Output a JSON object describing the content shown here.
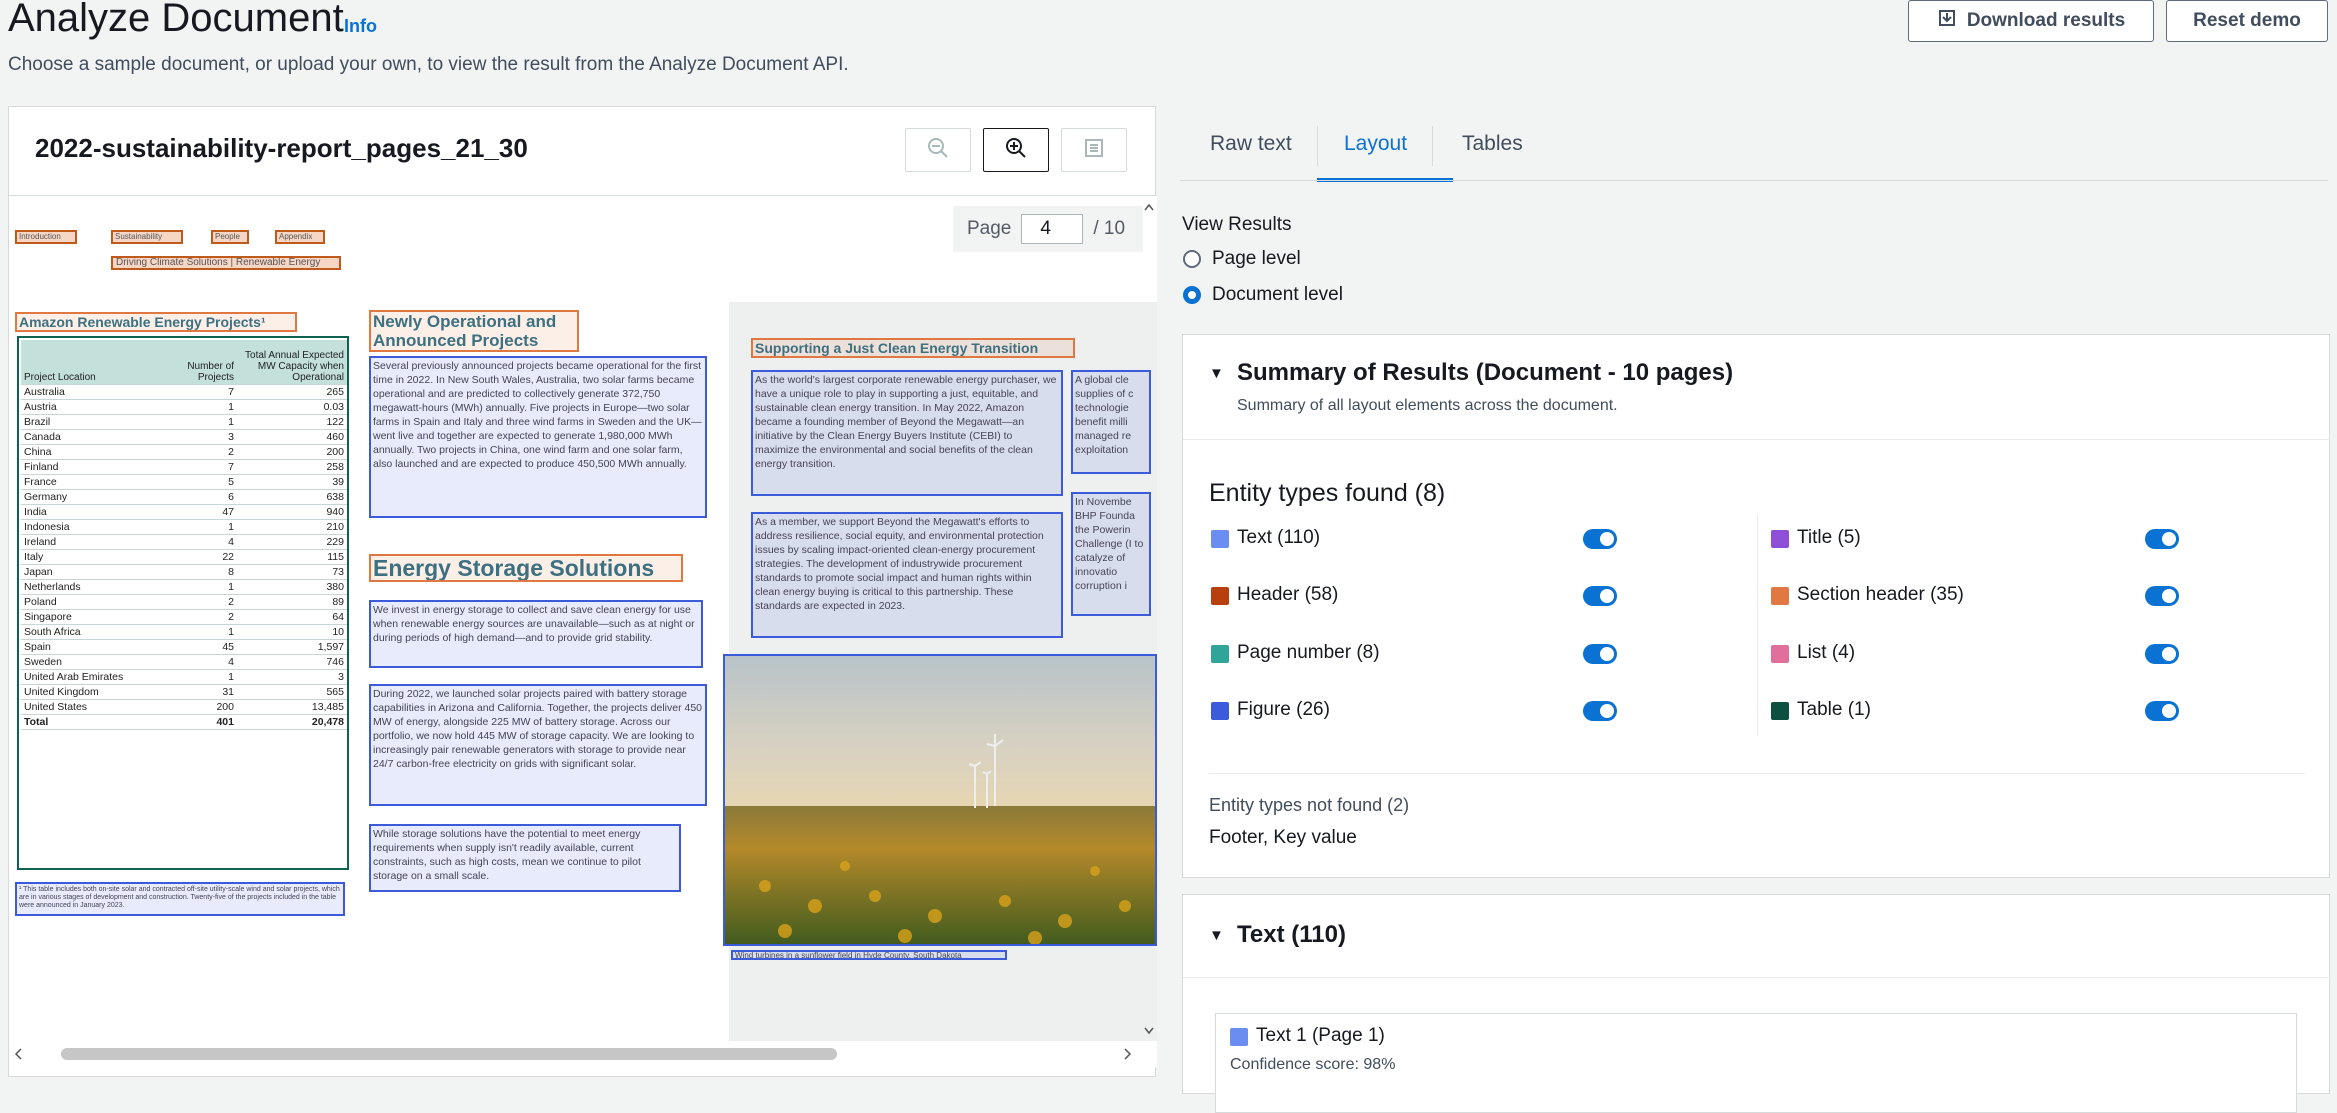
{
  "page": {
    "title": "Analyze Document",
    "info_link": "Info",
    "subtitle": "Choose a sample document, or upload your own, to view the result from the Analyze Document API.",
    "download_label": "Download results",
    "reset_label": "Reset demo"
  },
  "viewer": {
    "doc_title": "2022-sustainability-report_pages_21_30",
    "page_label": "Page",
    "page_value": "4",
    "page_total": "/ 10",
    "nav": [
      "Introduction",
      "Sustainability",
      "People",
      "Appendix"
    ],
    "subnav": "Driving Climate Solutions | Renewable Energy",
    "left_heading": "Amazon Renewable Energy Projects¹",
    "table_headers": [
      "Project Location",
      "Number of Projects",
      "Total Annual Expected MW Capacity when Operational"
    ],
    "table_rows": [
      [
        "Australia",
        "7",
        "265"
      ],
      [
        "Austria",
        "1",
        "0.03"
      ],
      [
        "Brazil",
        "1",
        "122"
      ],
      [
        "Canada",
        "3",
        "460"
      ],
      [
        "China",
        "2",
        "200"
      ],
      [
        "Finland",
        "7",
        "258"
      ],
      [
        "France",
        "5",
        "39"
      ],
      [
        "Germany",
        "6",
        "638"
      ],
      [
        "India",
        "47",
        "940"
      ],
      [
        "Indonesia",
        "1",
        "210"
      ],
      [
        "Ireland",
        "4",
        "229"
      ],
      [
        "Italy",
        "22",
        "115"
      ],
      [
        "Japan",
        "8",
        "73"
      ],
      [
        "Netherlands",
        "1",
        "380"
      ],
      [
        "Poland",
        "2",
        "89"
      ],
      [
        "Singapore",
        "2",
        "64"
      ],
      [
        "South Africa",
        "1",
        "10"
      ],
      [
        "Spain",
        "45",
        "1,597"
      ],
      [
        "Sweden",
        "4",
        "746"
      ],
      [
        "United Arab Emirates",
        "1",
        "3"
      ],
      [
        "United Kingdom",
        "31",
        "565"
      ],
      [
        "United States",
        "200",
        "13,485"
      ],
      [
        "Total",
        "401",
        "20,478"
      ]
    ],
    "table_footnote": "¹ This table includes both on-site solar and contracted off-site utility-scale wind and solar projects, which are in various stages of development and construction. Twenty-five of the projects included in the table were announced in January 2023.",
    "mid_heading": "Newly Operational and Announced Projects",
    "mid_para": "Several previously announced projects became operational for the first time in 2022. In New South Wales, Australia, two solar farms became operational and are predicted to collectively generate 372,750 megawatt-hours (MWh) annually. Five projects in Europe—two solar farms in Spain and Italy and three wind farms in Sweden and the UK—went live and together are expected to generate 1,980,000 MWh annually. Two projects in China, one wind farm and one solar farm, also launched and are expected to produce 450,500 MWh annually.",
    "storage_heading": "Energy Storage Solutions",
    "storage_p1": "We invest in energy storage to collect and save clean energy for use when renewable energy sources are unavailable—such as at night or during periods of high demand—and to provide grid stability.",
    "storage_p2": "During 2022, we launched solar projects paired with battery storage capabilities in Arizona and California. Together, the projects deliver 450 MW of energy, alongside 225 MW of battery storage. Across our portfolio, we now hold 445 MW of storage capacity. We are looking to increasingly pair renewable generators with storage to provide near 24/7 carbon-free electricity on grids with significant solar.",
    "storage_p3": "While storage solutions have the potential to meet energy requirements when supply isn't readily available, current constraints, such as high costs, mean we continue to pilot storage on a small scale.",
    "right_heading": "Supporting a Just Clean Energy Transition",
    "right_p1": "As the world's largest corporate renewable energy purchaser, we have a unique role to play in supporting a just, equitable, and sustainable clean energy transition. In May 2022, Amazon became a founding member of Beyond the Megawatt—an initiative by the Clean Energy Buyers Institute (CEBI) to maximize the environmental and social benefits of the clean energy transition.",
    "right_p2": "As a member, we support Beyond the Megawatt's efforts to address resilience, social equity, and environmental protection issues by scaling impact-oriented clean-energy procurement strategies. The development of industrywide procurement standards to promote social impact and human rights within clean energy buying is critical to this partnership. These standards are expected in 2023.",
    "far_p1": "A global cle supplies of c technologie benefit milli managed re exploitation",
    "far_p2": "In Novembe BHP Founda the Powerin Challenge (I to catalyze of innovatio corruption i",
    "photo_caption": "Wind turbines in a sunflower field in Hyde County, South Dakota"
  },
  "results": {
    "tabs": [
      "Raw text",
      "Layout",
      "Tables"
    ],
    "active_tab": "Layout",
    "view_results_label": "View Results",
    "radio_page": "Page level",
    "radio_document": "Document level",
    "summary_title": "Summary of Results (Document - 10 pages)",
    "summary_sub": "Summary of all layout elements across the document.",
    "entities_found_title": "Entity types found (8)",
    "entities": [
      {
        "label": "Text (110)",
        "color": "#6b8cf0"
      },
      {
        "label": "Title (5)",
        "color": "#8f4fd8"
      },
      {
        "label": "Header (58)",
        "color": "#b8400e"
      },
      {
        "label": "Section header (35)",
        "color": "#e07941"
      },
      {
        "label": "Page number (8)",
        "color": "#2ea597"
      },
      {
        "label": "List (4)",
        "color": "#e0709b"
      },
      {
        "label": "Figure (26)",
        "color": "#3b5bdb"
      },
      {
        "label": "Table (1)",
        "color": "#0e5040"
      }
    ],
    "not_found_title": "Entity types not found (2)",
    "not_found_list": "Footer, Key value",
    "text_section_title": "Text (110)",
    "text_item_title": "Text 1 (Page 1)",
    "text_item_conf": "Confidence score: 98%"
  }
}
